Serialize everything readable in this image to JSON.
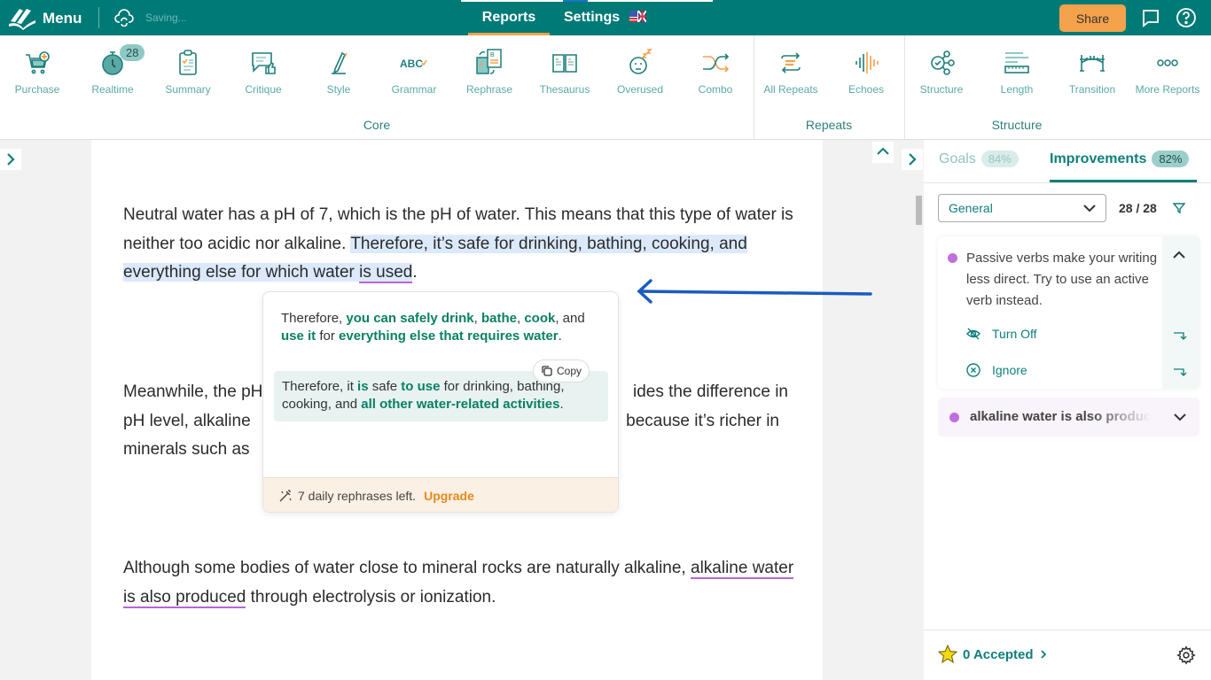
{
  "topbar": {
    "menu_label": "Menu",
    "saving_status": "Saving...",
    "tabs": [
      {
        "label": "Reports",
        "active": true
      },
      {
        "label": "Settings",
        "active": false
      }
    ],
    "share_label": "Share",
    "accent_color": "#007a76",
    "share_color": "#f4a24b"
  },
  "ribbon": {
    "groups": [
      {
        "label": "Core",
        "items": [
          {
            "label": "Purchase",
            "icon": "cart-plus-icon"
          },
          {
            "label": "Realtime",
            "icon": "stopwatch-icon",
            "badge": "28"
          },
          {
            "label": "Summary",
            "icon": "clipboard-icon"
          },
          {
            "label": "Critique",
            "icon": "chat-thumbs-up-icon"
          },
          {
            "label": "Style",
            "icon": "pen-icon"
          },
          {
            "label": "Grammar",
            "icon": "abc-check-icon"
          },
          {
            "label": "Rephrase",
            "icon": "rephrase-docs-icon"
          },
          {
            "label": "Thesaurus",
            "icon": "open-book-icon"
          },
          {
            "label": "Overused",
            "icon": "sleepy-face-icon"
          },
          {
            "label": "Combo",
            "icon": "shuffle-icon"
          }
        ]
      },
      {
        "label": "Repeats",
        "items": [
          {
            "label": "All Repeats",
            "icon": "repeat-arrows-icon"
          },
          {
            "label": "Echoes",
            "icon": "sound-wave-icon"
          }
        ]
      },
      {
        "label": "Structure",
        "items": [
          {
            "label": "Structure",
            "icon": "nodes-icon"
          },
          {
            "label": "Length",
            "icon": "ruler-lines-icon"
          },
          {
            "label": "Transition",
            "icon": "bridge-icon"
          },
          {
            "label": "More Reports",
            "icon": "more-dots-icon"
          }
        ]
      }
    ]
  },
  "document": {
    "p1": {
      "plain": "Neutral water has a pH of 7, which is the pH of water. This means that this type of water is neither too acidic nor alkaline. ",
      "highlight_a": "Therefore, it’s safe for drinking, bathing, cooking, and everything else for which water ",
      "flagged": "is used",
      "end": "."
    },
    "p2": {
      "line1_start": "Meanwhile, the pH",
      "line1_end": "ides the difference in",
      "line2_start": "pH level, alkaline ",
      "line2_end": "because it’s richer in",
      "line3_start": "minerals such as "
    },
    "p3": {
      "plain": "Although some bodies of water close to mineral rocks are naturally alkaline, ",
      "flagged": "alkaline water is also produced",
      "end": " through electrolysis or ionization."
    }
  },
  "popup": {
    "option1": [
      {
        "t": "Therefore, ",
        "g": false
      },
      {
        "t": "you can safely drink",
        "g": true
      },
      {
        "t": ", ",
        "g": false
      },
      {
        "t": "bathe",
        "g": true
      },
      {
        "t": ", ",
        "g": false
      },
      {
        "t": "cook",
        "g": true
      },
      {
        "t": ", and ",
        "g": false
      },
      {
        "t": "use it",
        "g": true
      },
      {
        "t": " for ",
        "g": false
      },
      {
        "t": "everything else that requires water",
        "g": true
      },
      {
        "t": ".",
        "g": false
      }
    ],
    "option2": [
      {
        "t": "Therefore, it ",
        "g": false
      },
      {
        "t": "is",
        "g": true
      },
      {
        "t": " safe ",
        "g": false
      },
      {
        "t": "to use",
        "g": true
      },
      {
        "t": " for drinking, bathing, cooking, and ",
        "g": false
      },
      {
        "t": "all other water-related activities",
        "g": true
      },
      {
        "t": ".",
        "g": false
      }
    ],
    "copy_label": "Copy",
    "footer_text": "7 daily rephrases left.",
    "upgrade_label": "Upgrade"
  },
  "right_panel": {
    "tabs": [
      {
        "label": "Goals",
        "percent": "84%",
        "active": false
      },
      {
        "label": "Improvements",
        "percent": "82%",
        "active": true
      }
    ],
    "filter_select": "General",
    "count": "28 / 28",
    "cards": [
      {
        "message": "Passive verbs make your writing less direct. Try to use an active verb instead.",
        "actions": [
          {
            "label": "Turn Off",
            "icon": "eye-off-icon"
          },
          {
            "label": "Ignore",
            "icon": "circle-x-icon"
          }
        ],
        "expanded": true
      },
      {
        "message": "alkaline water is also produced",
        "expanded": false
      }
    ],
    "accepted_label": "0 Accepted",
    "passive_color": "#bf6fdc"
  }
}
